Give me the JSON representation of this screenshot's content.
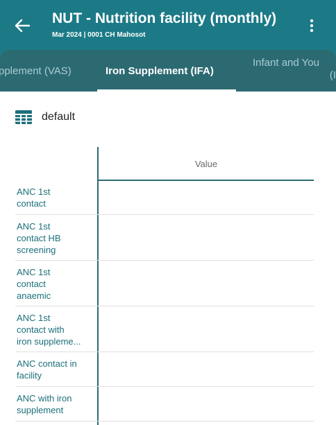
{
  "header": {
    "title": "NUT - Nutrition facility (monthly)",
    "subtitle": "Mar 2024 | 0001 CH Mahosot"
  },
  "tabs": [
    {
      "label": "pplement (VAS)",
      "active": false
    },
    {
      "label": "Iron Supplement (IFA)",
      "active": true
    },
    {
      "label": "Infant and Young Child Feeding (I...",
      "active": false
    }
  ],
  "tab_partial": {
    "line1": "Infant and You",
    "line2": "(I"
  },
  "section": {
    "icon": "table-icon",
    "label": "default"
  },
  "table": {
    "column_header": "Value",
    "rows": [
      {
        "label": "ANC 1st\ncontact",
        "value": ""
      },
      {
        "label": "ANC 1st\ncontact HB\nscreening",
        "value": ""
      },
      {
        "label": "ANC 1st\ncontact\nanaemic",
        "value": ""
      },
      {
        "label": "ANC 1st\ncontact with\niron suppleme...",
        "value": ""
      },
      {
        "label": "ANC contact in\nfacility",
        "value": ""
      },
      {
        "label": "ANC with iron\nsupplement",
        "value": ""
      }
    ]
  },
  "colors": {
    "primary": "#1c7a87",
    "tab_bg": "#2c6a72",
    "label": "#1c6f7b"
  }
}
